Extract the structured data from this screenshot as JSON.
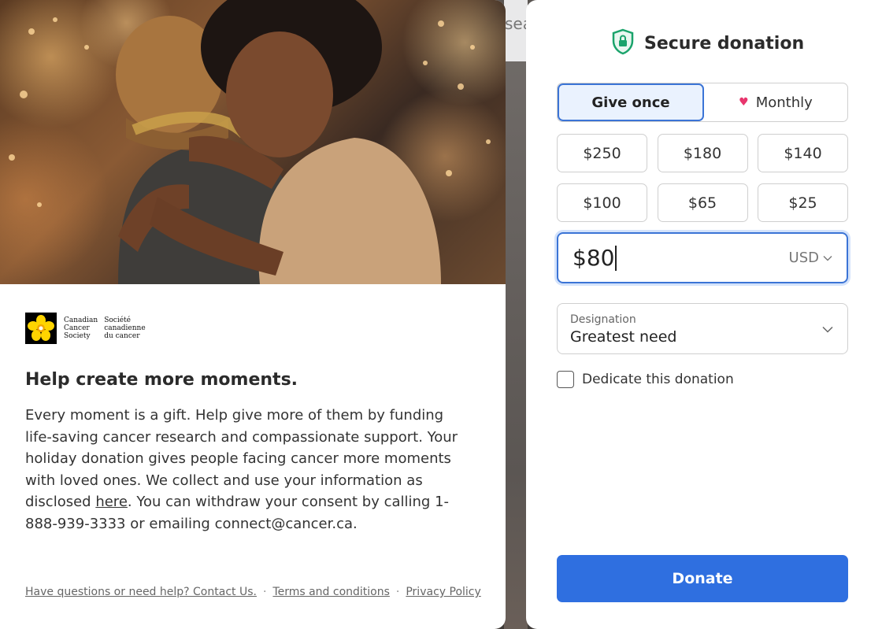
{
  "backdrop": {
    "partial_text": "sea"
  },
  "campaign": {
    "logo": {
      "english_lines": [
        "Canadian",
        "Cancer",
        "Society"
      ],
      "french_lines": [
        "Société",
        "canadienne",
        "du cancer"
      ]
    },
    "headline": "Help create more moments.",
    "body_before_link": "Every moment is a gift. Help give more of them by funding life-saving cancer research and compassionate support. Your holiday donation gives people facing cancer more moments with loved ones. We collect and use your information as disclosed ",
    "body_link": "here",
    "body_after_link": ". You can withdraw your consent by calling 1-888-939-3333 or emailing connect@cancer.ca.",
    "footer": {
      "help_link": "Have questions or need help? Contact Us.",
      "separator": "·",
      "terms_link": "Terms and conditions",
      "privacy_link": "Privacy Policy"
    }
  },
  "donation": {
    "title": "Secure donation",
    "frequency": {
      "once_label": "Give once",
      "monthly_label": "Monthly",
      "selected": "Give once"
    },
    "amounts": [
      "$250",
      "$180",
      "$140",
      "$100",
      "$65",
      "$25"
    ],
    "custom_amount": "$80",
    "currency": "USD",
    "designation": {
      "label": "Designation",
      "value": "Greatest need"
    },
    "dedicate_label": "Dedicate this donation",
    "dedicate_checked": false,
    "donate_label": "Donate"
  },
  "colors": {
    "accent": "#2f6fe0",
    "active_border": "#3b74d6",
    "secure_icon": "#1aa36b",
    "heart": "#e8356d",
    "logo_yellow": "#ffd400"
  }
}
